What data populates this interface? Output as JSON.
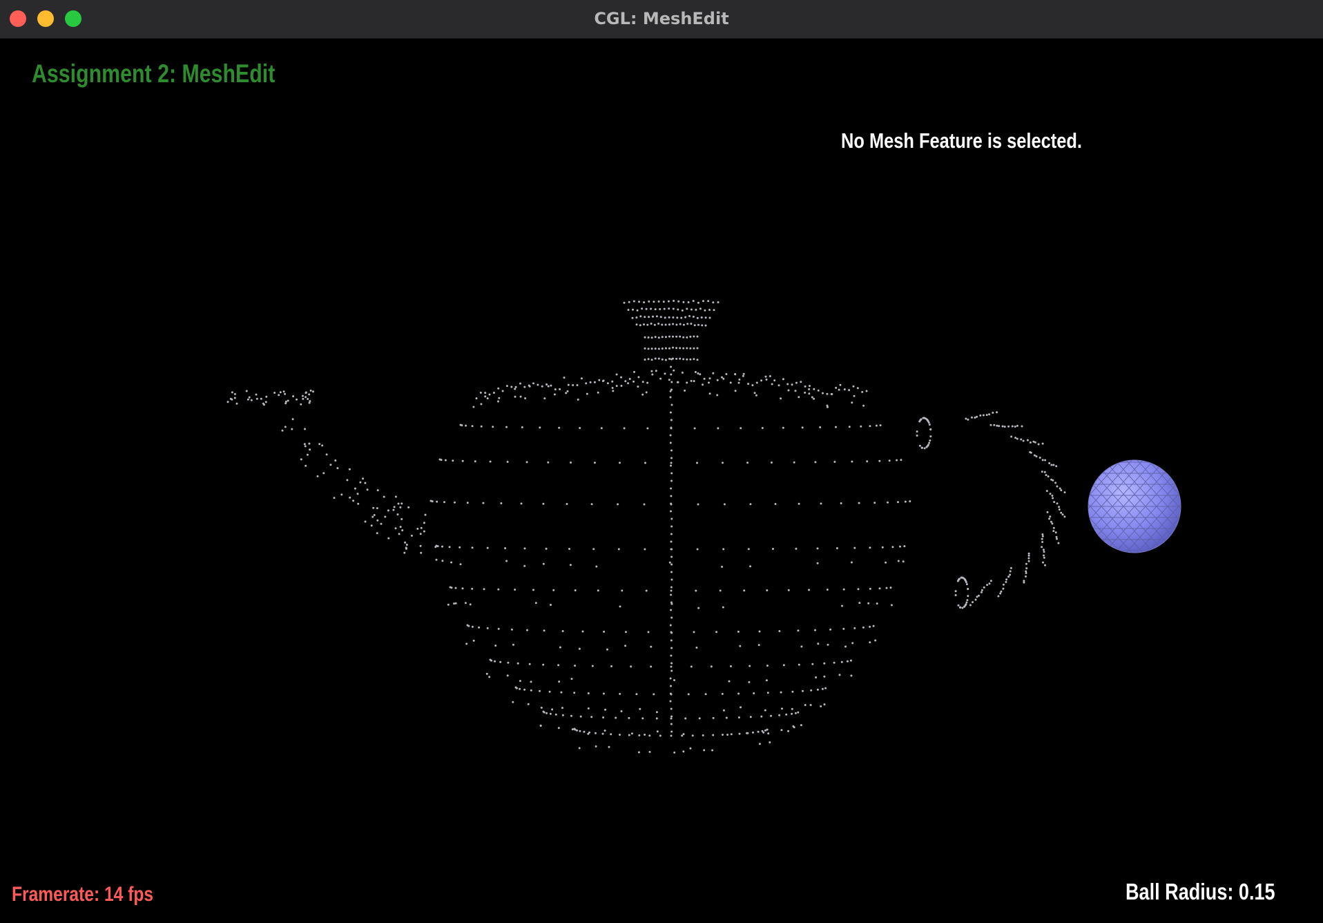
{
  "window": {
    "title": "CGL: MeshEdit",
    "buttons": [
      "close",
      "minimize",
      "maximize"
    ]
  },
  "hud": {
    "assignment_title": "Assignment 2: MeshEdit",
    "selection_status": "No Mesh Feature is selected.",
    "framerate": "Framerate: 14 fps",
    "ball_radius": "Ball Radius: 0.15"
  },
  "colors": {
    "title_green": "#2e8b2e",
    "framerate_red": "#ff5a5a",
    "vertex_gray": "#b8b8c0",
    "ball_fill": "#8a8cf0",
    "background": "#000000"
  },
  "scene": {
    "mesh": "teapot-point-cloud",
    "ball": "sphere-wireframe"
  }
}
